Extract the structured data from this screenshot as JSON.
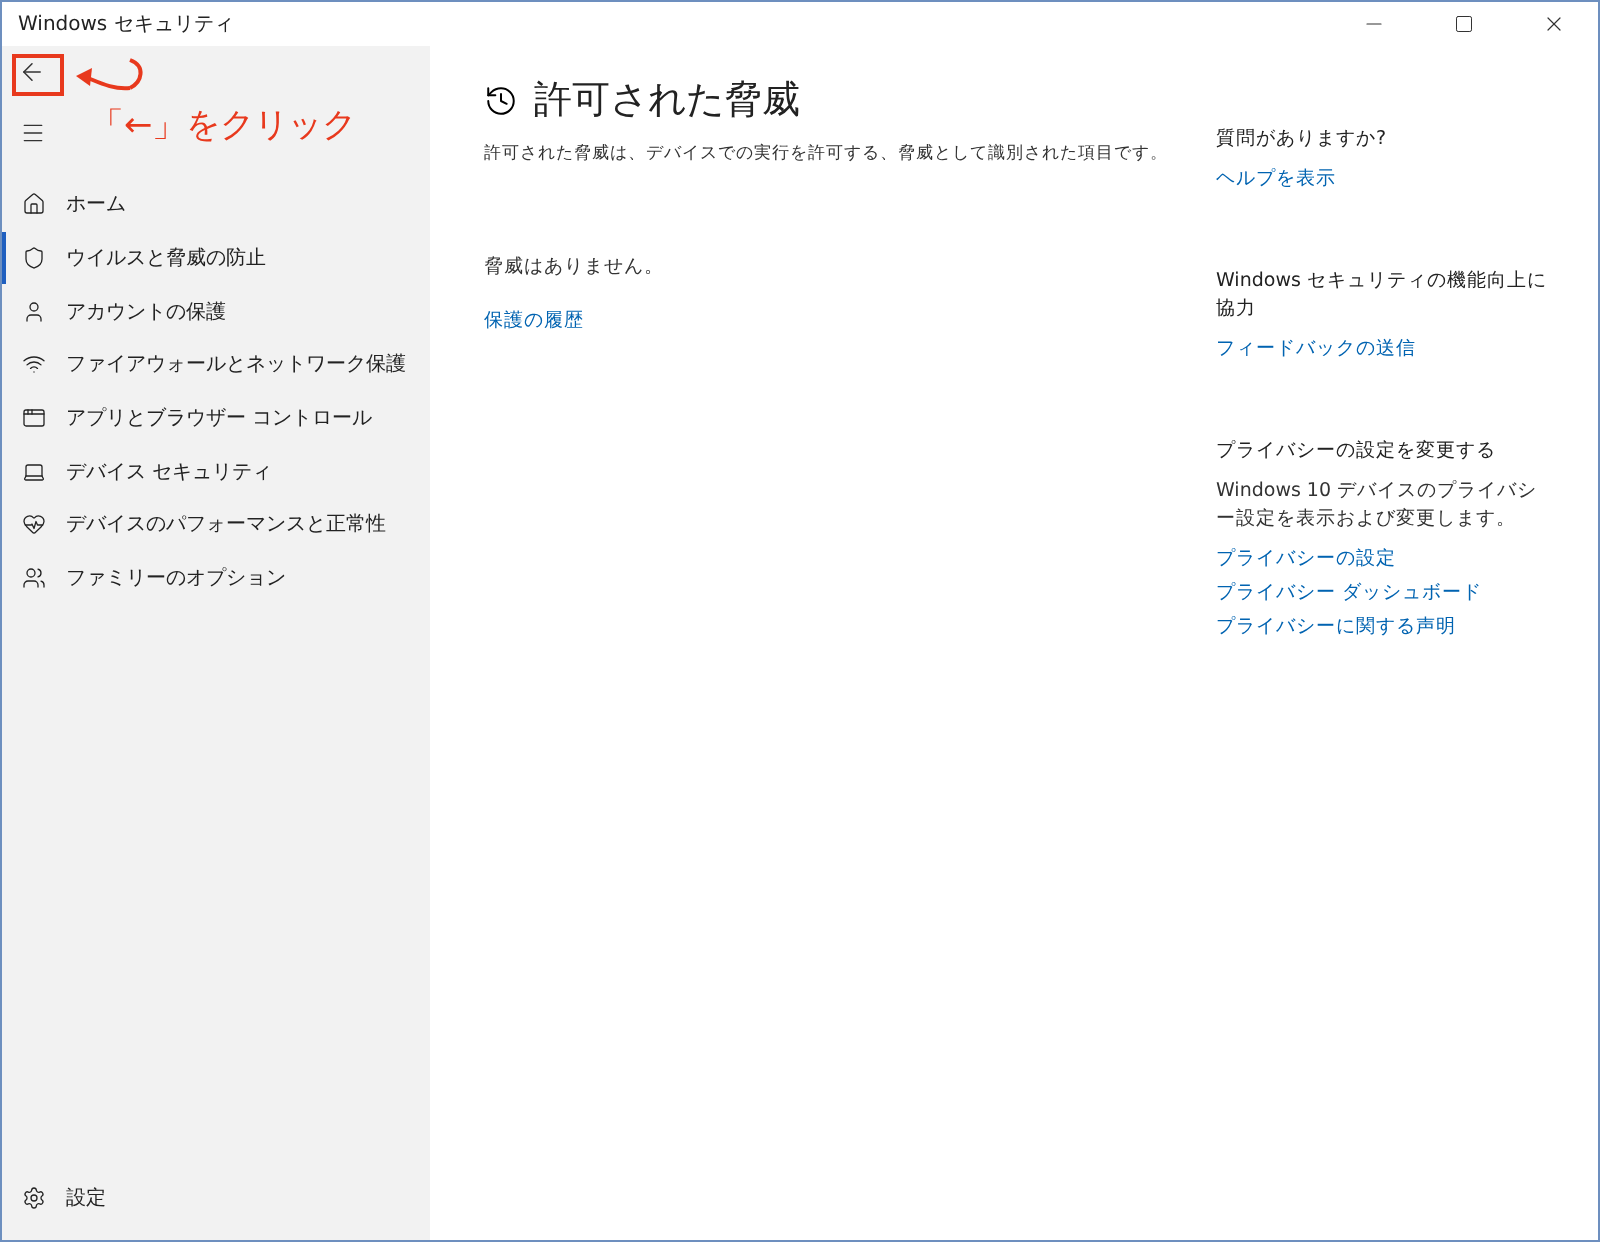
{
  "window": {
    "title": "Windows セキュリティ"
  },
  "annotation": {
    "text": "「←」をクリック"
  },
  "sidebar": {
    "items": [
      {
        "label": "ホーム",
        "selected": false
      },
      {
        "label": "ウイルスと脅威の防止",
        "selected": true
      },
      {
        "label": "アカウントの保護",
        "selected": false
      },
      {
        "label": "ファイアウォールとネットワーク保護",
        "selected": false
      },
      {
        "label": "アプリとブラウザー コントロール",
        "selected": false
      },
      {
        "label": "デバイス セキュリティ",
        "selected": false
      },
      {
        "label": "デバイスのパフォーマンスと正常性",
        "selected": false
      },
      {
        "label": "ファミリーのオプション",
        "selected": false
      }
    ],
    "settings": "設定"
  },
  "main": {
    "title": "許可された脅威",
    "description": "許可された脅威は、デバイスでの実行を許可する、脅威として識別された項目です。",
    "status": "脅威はありません。",
    "link": "保護の履歴"
  },
  "aside": [
    {
      "heading": "質問がありますか?",
      "links": [
        "ヘルプを表示"
      ]
    },
    {
      "heading": "Windows セキュリティの機能向上に協力",
      "links": [
        "フィードバックの送信"
      ]
    },
    {
      "heading": "プライバシーの設定を変更する",
      "text": "Windows 10 デバイスのプライバシー設定を表示および変更します。",
      "links": [
        "プライバシーの設定",
        "プライバシー ダッシュボード",
        "プライバシーに関する声明"
      ]
    }
  ]
}
